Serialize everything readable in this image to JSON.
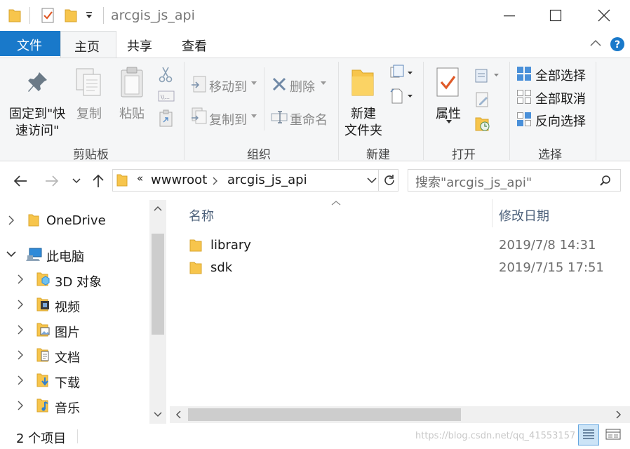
{
  "window": {
    "title": "arcgis_js_api",
    "minimize_icon": "minimize-icon",
    "maximize_icon": "maximize-icon",
    "close_icon": "close-icon"
  },
  "ribbon_tabs": {
    "file": "文件",
    "home": "主页",
    "share": "共享",
    "view": "查看"
  },
  "ribbon": {
    "clipboard": {
      "pin_line1": "固定到\"快",
      "pin_line2": "速访问\"",
      "copy": "复制",
      "paste": "粘贴",
      "group": "剪贴板"
    },
    "organize": {
      "move_to": "移动到",
      "copy_to": "复制到",
      "delete": "删除",
      "rename": "重命名",
      "group": "组织"
    },
    "new": {
      "new_folder_line1": "新建",
      "new_folder_line2": "文件夹",
      "group": "新建"
    },
    "open": {
      "properties": "属性",
      "group": "打开"
    },
    "select": {
      "select_all": "全部选择",
      "select_none": "全部取消",
      "invert": "反向选择",
      "group": "选择"
    }
  },
  "navigation": {
    "chevrons": "«",
    "breadcrumb": [
      "wwwroot",
      "arcgis_js_api"
    ],
    "search_placeholder": "搜索\"arcgis_js_api\""
  },
  "nav_pane": {
    "items": [
      {
        "label": "OneDrive",
        "icon": "folder-icon"
      },
      {
        "label": "此电脑",
        "icon": "computer-icon"
      },
      {
        "label": "3D 对象",
        "icon": "3d-objects-icon"
      },
      {
        "label": "视频",
        "icon": "videos-icon"
      },
      {
        "label": "图片",
        "icon": "pictures-icon"
      },
      {
        "label": "文档",
        "icon": "documents-icon"
      },
      {
        "label": "下载",
        "icon": "downloads-icon"
      },
      {
        "label": "音乐",
        "icon": "music-icon"
      }
    ]
  },
  "file_list": {
    "columns": [
      "名称",
      "修改日期"
    ],
    "rows": [
      {
        "name": "library",
        "modified": "2019/7/8 14:31"
      },
      {
        "name": "sdk",
        "modified": "2019/7/15 17:51"
      }
    ]
  },
  "status": {
    "count": "2 个项目",
    "watermark": "https://blog.csdn.net/qq_41553157"
  },
  "colors": {
    "accent": "#1979ca",
    "folder": "#f7c54c",
    "ribbon_bg": "#f5f6f7"
  }
}
